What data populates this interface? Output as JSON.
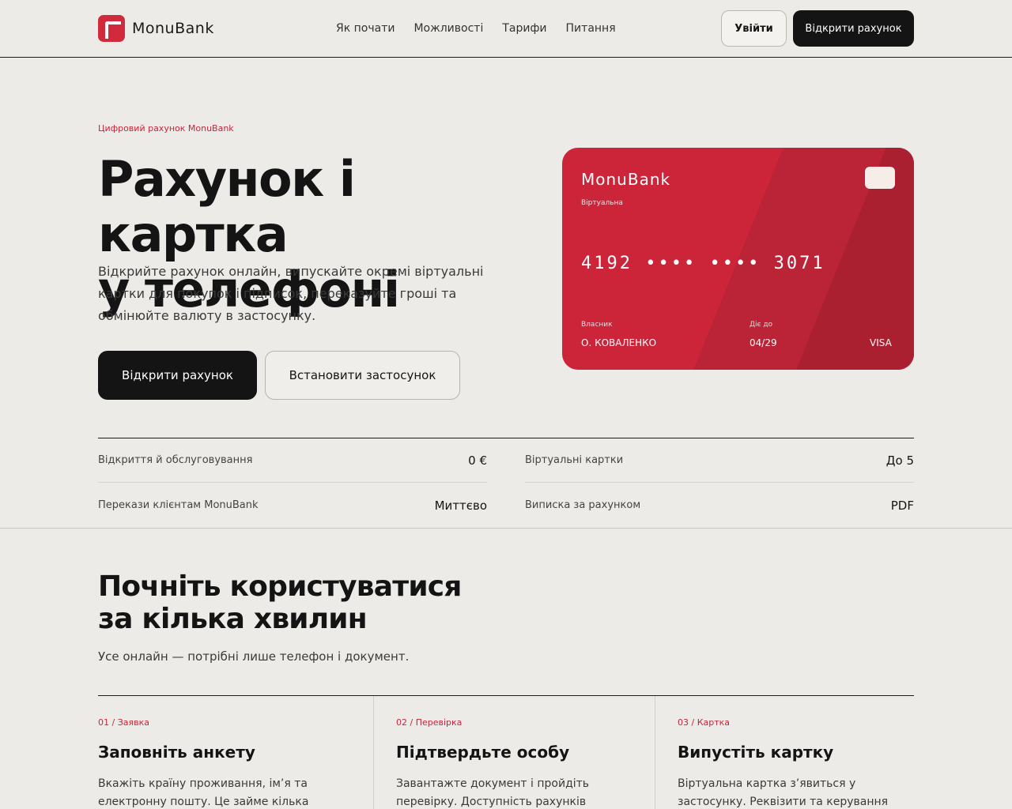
{
  "header": {
    "brand": "MonuBank",
    "nav": [
      "Як почати",
      "Можливості",
      "Тарифи",
      "Питання"
    ],
    "login_label": "Увійти",
    "open_account_label": "Відкрити рахунок"
  },
  "hero": {
    "eyebrow": "Цифровий рахунок MonuBank",
    "title_line1": "Рахунок і картка",
    "title_line2": "у телефоні",
    "description": "Відкрийте рахунок онлайн, випускайте окремі віртуальні картки для покупок і підписок, переказуйте гроші та обмінюйте валюту в застосунку.",
    "primary_button": "Відкрити рахунок",
    "secondary_button": "Встановити застосунок"
  },
  "card": {
    "brand": "MonuBank",
    "type": "Віртуальна",
    "number": "4192 •••• •••• 3071",
    "holder_label": "Власник",
    "holder": "О. КОВАЛЕНКО",
    "expiry_label": "Діє до",
    "expiry": "04/29",
    "network": "VISA",
    "colors": {
      "base": "#cc2539",
      "band1": "#b92336",
      "band2": "#a81f31"
    }
  },
  "stats": [
    {
      "label": "Відкриття й обслуговування",
      "value": "0 €"
    },
    {
      "label": "Віртуальні картки",
      "value": "До 5"
    },
    {
      "label": "Перекази клієнтам MonuBank",
      "value": "Миттєво"
    },
    {
      "label": "Виписка за рахунком",
      "value": "PDF"
    }
  ],
  "start_section": {
    "title_line1": "Почніть користуватися",
    "title_line2": "за кілька хвилин",
    "subtitle": "Усе онлайн — потрібні лише телефон і документ.",
    "steps": [
      {
        "eyebrow": "01 / Заявка",
        "title": "Заповніть анкету",
        "text": "Вкажіть країну проживання, ім’я та електронну пошту. Це займе кілька хвилин."
      },
      {
        "eyebrow": "02 / Перевірка",
        "title": "Підтвердьте особу",
        "text": "Завантажте документ і пройдіть перевірку. Доступність рахунків залежить від країни"
      },
      {
        "eyebrow": "03 / Картка",
        "title": "Випустіть картку",
        "text": "Віртуальна картка з’явиться у застосунку. Реквізити та керування карткою будуть там"
      }
    ]
  },
  "accent_color": "#c8243a"
}
